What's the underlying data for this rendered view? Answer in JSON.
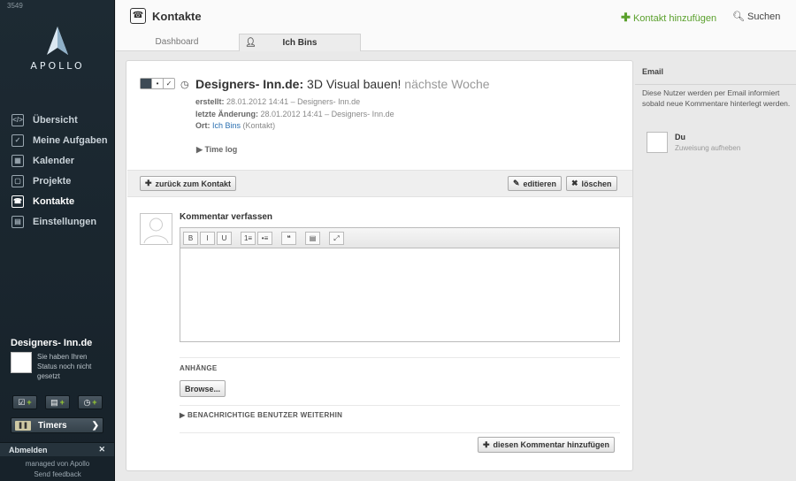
{
  "sidebar": {
    "build": "3549",
    "logo_text": "APOLLO",
    "nav": [
      {
        "label": "Übersicht",
        "icon": "overview-icon",
        "glyph": "</>"
      },
      {
        "label": "Meine Aufgaben",
        "icon": "tasks-checkbox-icon",
        "glyph": "✓"
      },
      {
        "label": "Kalender",
        "icon": "calendar-icon",
        "glyph": "▦"
      },
      {
        "label": "Projekte",
        "icon": "projects-icon",
        "glyph": "▢"
      },
      {
        "label": "Kontakte",
        "icon": "contacts-icon",
        "glyph": "☎",
        "active": true
      },
      {
        "label": "Einstellungen",
        "icon": "settings-icon",
        "glyph": "▤"
      }
    ],
    "project_name": "Designers- Inn.de",
    "status_text": "Sie haben Ihren Status noch nicht gesetzt",
    "timers_label": "Timers",
    "logout_label": "Abmelden",
    "managed_by": "managed von Apollo",
    "feedback": "Send feedback"
  },
  "header": {
    "title": "Kontakte",
    "add_contact": "Kontakt hinzufügen",
    "search": "Suchen",
    "tabs": [
      "Dashboard",
      "Ich Bins"
    ]
  },
  "task": {
    "company": "Designers- Inn.de:",
    "title": "3D Visual bauen!",
    "due": "nächste Woche",
    "created_label": "erstellt:",
    "created_value": "28.01.2012 14:41 – Designers- Inn.de",
    "changed_label": "letzte Änderung:",
    "changed_value": "28.01.2012 14:41 – Designers- Inn.de",
    "place_label": "Ort:",
    "place_link": "Ich Bins",
    "place_suffix": "(Kontakt)",
    "timelog": "Time log"
  },
  "actions": {
    "back": "zurück zum Kontakt",
    "edit": "editieren",
    "delete": "löschen"
  },
  "comment": {
    "title": "Kommentar verfassen",
    "toolbar": [
      "B",
      "I",
      "U",
      "1≡",
      "•≡",
      "❝",
      "▤",
      "⤢"
    ],
    "attachments": "ANHÄNGE",
    "browse": "Browse...",
    "notify": "BENACHRICHTIGE BENUTZER WEITERHIN",
    "submit": "diesen Kommentar hinzufügen"
  },
  "email_panel": {
    "title": "Email",
    "info": "Diese Nutzer werden per Email informiert sobald neue Kommentare hinterlegt werden.",
    "user": "Du",
    "unassign": "Zuweisung aufheben"
  }
}
